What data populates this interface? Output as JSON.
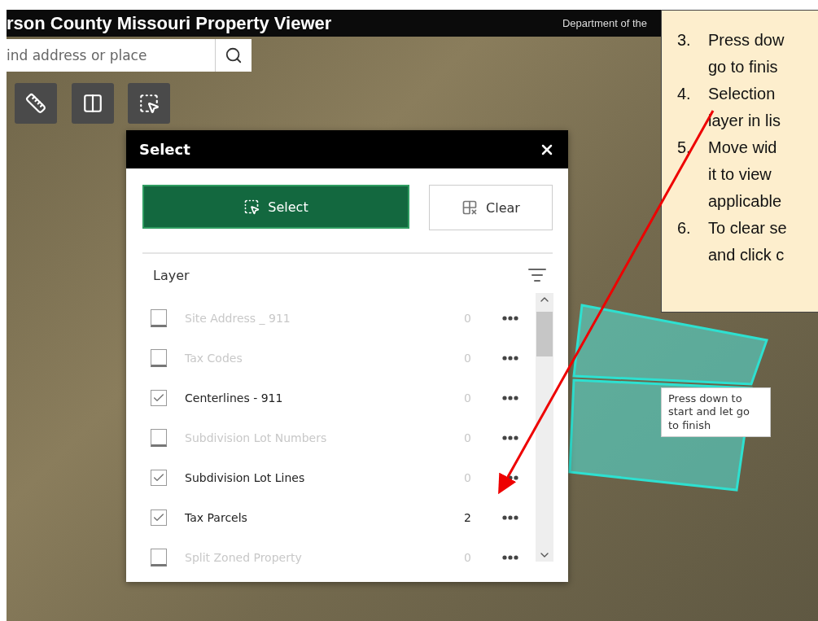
{
  "header": {
    "title": "rson County Missouri Property Viewer",
    "subtitle": "Department of the"
  },
  "search": {
    "placeholder": "ind address or place"
  },
  "select_panel": {
    "title": "Select",
    "buttons": [
      {
        "label": "Select",
        "kind": "primary"
      },
      {
        "label": "Clear",
        "kind": "secondary"
      }
    ],
    "layer_label": "Layer",
    "layers": [
      {
        "name": "Site Address _ 911",
        "count": "0",
        "checked": false
      },
      {
        "name": "Tax Codes",
        "count": "0",
        "checked": false
      },
      {
        "name": "Centerlines - 911",
        "count": "0",
        "checked": true
      },
      {
        "name": "Subdivision Lot Numbers",
        "count": "0",
        "checked": false
      },
      {
        "name": "Subdivision Lot Lines",
        "count": "0",
        "checked": true
      },
      {
        "name": "Tax Parcels",
        "count": "2",
        "checked": true
      },
      {
        "name": "Split Zoned Property",
        "count": "0",
        "checked": false
      }
    ]
  },
  "map_tooltip": "Press down to start and let go to finish",
  "instructions": [
    {
      "number": "3.",
      "lines": [
        "Press dow",
        "go to finis"
      ]
    },
    {
      "number": "4.",
      "lines": [
        "Selection",
        "layer in lis"
      ]
    },
    {
      "number": "5.",
      "lines": [
        "Move wid",
        "it to view",
        "applicable"
      ]
    },
    {
      "number": "6.",
      "lines": [
        "To clear se",
        "and click c"
      ]
    }
  ]
}
